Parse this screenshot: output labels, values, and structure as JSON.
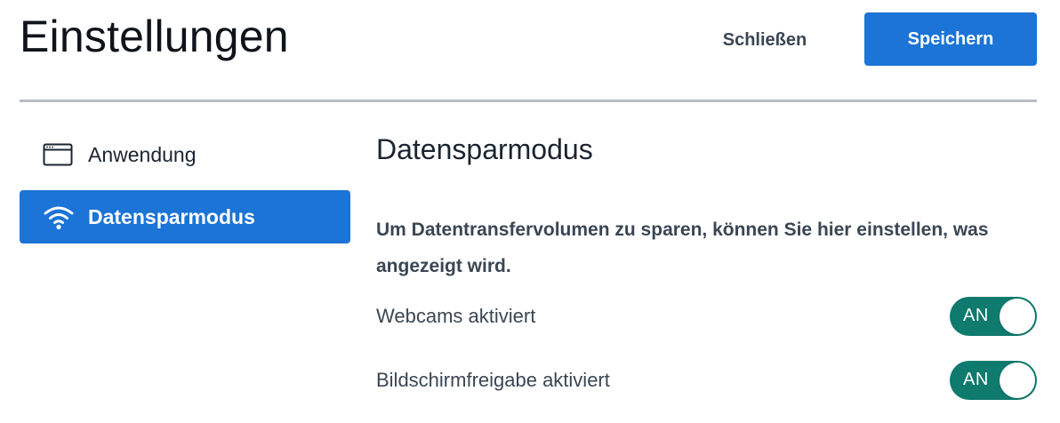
{
  "header": {
    "title": "Einstellungen",
    "close_label": "Schließen",
    "save_label": "Speichern"
  },
  "sidebar": {
    "items": [
      {
        "label": "Anwendung",
        "icon": "application-window-icon",
        "active": false
      },
      {
        "label": "Datensparmodus",
        "icon": "wifi-icon",
        "active": true
      }
    ]
  },
  "main": {
    "section_title": "Datensparmodus",
    "description": "Um Datentransfervolumen zu sparen, können Sie hier einstellen, was angezeigt wird.",
    "settings": [
      {
        "label": "Webcams aktiviert",
        "toggle_text": "AN",
        "on": true
      },
      {
        "label": "Bildschirmfreigabe aktiviert",
        "toggle_text": "AN",
        "on": true
      }
    ]
  },
  "colors": {
    "primary": "#1b74d6",
    "toggle_on": "#0f7a6e",
    "divider": "#b8bdc4",
    "text_secondary": "#3b4654"
  }
}
